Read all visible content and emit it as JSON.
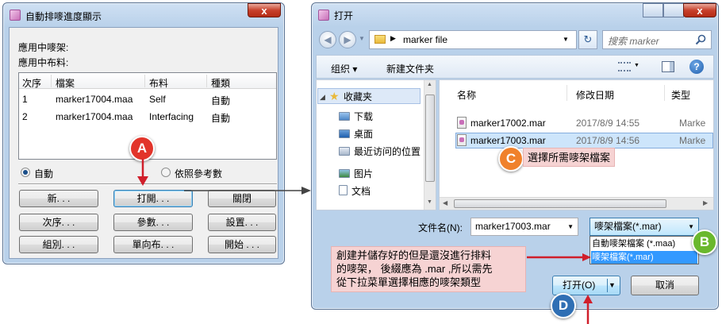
{
  "left_dialog": {
    "title": "自動排嘜進度顯示",
    "close_glyph": "x",
    "label_marker": "應用中嘜架:",
    "label_fabric": "應用中布料:",
    "table": {
      "headers": [
        "次序",
        "檔案",
        "布料",
        "種類"
      ],
      "rows": [
        {
          "order": "1",
          "file": "marker17004.maa",
          "fabric": "Self",
          "type": "自動"
        },
        {
          "order": "2",
          "file": "marker17004.maa",
          "fabric": "Interfacing",
          "type": "自動"
        }
      ]
    },
    "radio_auto": "自動",
    "radio_ref": "依照參考數",
    "buttons": {
      "new": "新. . .",
      "open": "打開. . .",
      "close": "關閉",
      "order": "次序. . .",
      "params": "參數. . .",
      "settings": "設置. . .",
      "group": "組別. . .",
      "oneway": "單向布. . .",
      "start": "開始 . . ."
    }
  },
  "right_dialog": {
    "title": "打开",
    "address_path": "marker file",
    "search_placeholder": "搜索 marker",
    "toolbar": {
      "organize": "组织 ▾",
      "new_folder": "新建文件夹"
    },
    "sidebar": {
      "favorites": "收藏夹",
      "items": [
        "下载",
        "桌面",
        "最近访问的位置"
      ],
      "libraries": [
        "图片",
        "文档"
      ]
    },
    "columns": {
      "name": "名称",
      "modified": "修改日期",
      "type": "类型"
    },
    "files": [
      {
        "name": "marker17002.mar",
        "date": "2017/8/9 14:55",
        "type": "Marke"
      },
      {
        "name": "marker17003.mar",
        "date": "2017/8/9 14:56",
        "type": "Marke"
      }
    ],
    "filename_label": "文件名(N):",
    "filename_value": "marker17003.mar",
    "filter": {
      "selected": "嘜架檔案(*.mar)",
      "options": [
        "自動嘜架檔案 (*.maa)",
        "嘜架檔案(*.mar)"
      ]
    },
    "open_button": "打开(O)",
    "cancel_button": "取消"
  },
  "annotations": {
    "A": "A",
    "B": "B",
    "C": "C",
    "D": "D",
    "callout_c": "選擇所需嘜架檔案",
    "callout_b_line1": "創建并儲存好的但是還沒進行排料",
    "callout_b_line2": "的嘜架， 後綴應為 .mar ,所以需先",
    "callout_b_line3": "從下拉菜單選擇相應的嘜架類型"
  },
  "colors": {
    "badge_a": "#e2342a",
    "badge_b": "#6ab82d",
    "badge_c": "#f0812b",
    "badge_d": "#2f6fb4",
    "callout_bg": "#f6d3d3",
    "arrow": "#d01f2b",
    "selection": "#cde5fb"
  }
}
